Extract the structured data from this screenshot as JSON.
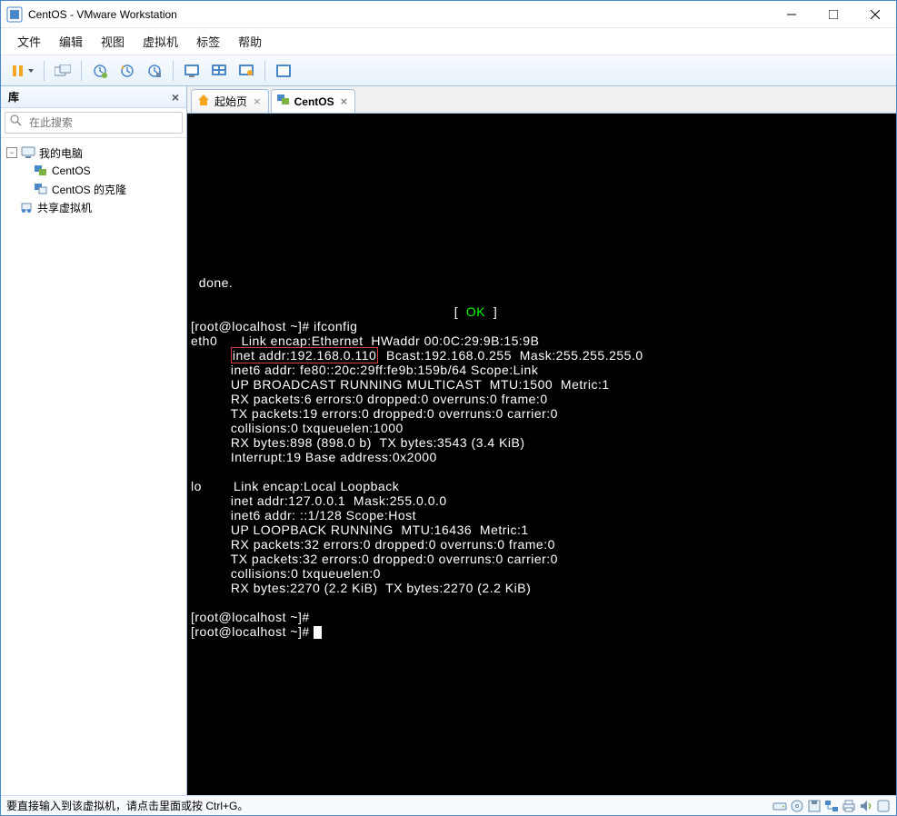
{
  "window": {
    "title": "CentOS - VMware Workstation"
  },
  "menu": {
    "file": "文件",
    "edit": "编辑",
    "view": "视图",
    "vm": "虚拟机",
    "tabs": "标签",
    "help": "帮助"
  },
  "sidebar": {
    "title": "库",
    "search_placeholder": "在此搜索",
    "nodes": {
      "mycomputer": "我的电脑",
      "centos": "CentOS",
      "centos_clone": "CentOS 的克隆",
      "shared": "共享虚拟机"
    }
  },
  "tabs": {
    "home": "起始页",
    "centos": "CentOS"
  },
  "terminal": {
    "done": "  done.",
    "ok": "OK",
    "prompt1": "[root@localhost ~]# ifconfig",
    "eth0": "eth0",
    "eth0_l1": "Link encap:Ethernet  HWaddr 00:0C:29:9B:15:9B",
    "eth0_inet": "inet addr:192.168.0.110",
    "eth0_l2b": "  Bcast:192.168.0.255  Mask:255.255.255.0",
    "eth0_l3": "inet6 addr: fe80::20c:29ff:fe9b:159b/64 Scope:Link",
    "eth0_l4": "UP BROADCAST RUNNING MULTICAST  MTU:1500  Metric:1",
    "eth0_l5": "RX packets:6 errors:0 dropped:0 overruns:0 frame:0",
    "eth0_l6": "TX packets:19 errors:0 dropped:0 overruns:0 carrier:0",
    "eth0_l7": "collisions:0 txqueuelen:1000",
    "eth0_l8": "RX bytes:898 (898.0 b)  TX bytes:3543 (3.4 KiB)",
    "eth0_l9": "Interrupt:19 Base address:0x2000",
    "lo": "lo",
    "lo_l1": "Link encap:Local Loopback",
    "lo_l2": "inet addr:127.0.0.1  Mask:255.0.0.0",
    "lo_l3": "inet6 addr: ::1/128 Scope:Host",
    "lo_l4": "UP LOOPBACK RUNNING  MTU:16436  Metric:1",
    "lo_l5": "RX packets:32 errors:0 dropped:0 overruns:0 frame:0",
    "lo_l6": "TX packets:32 errors:0 dropped:0 overruns:0 carrier:0",
    "lo_l7": "collisions:0 txqueuelen:0",
    "lo_l8": "RX bytes:2270 (2.2 KiB)  TX bytes:2270 (2.2 KiB)",
    "prompt2": "[root@localhost ~]#",
    "prompt3": "[root@localhost ~]# "
  },
  "statusbar": {
    "text": "要直接输入到该虚拟机，请点击里面或按 Ctrl+G。"
  }
}
